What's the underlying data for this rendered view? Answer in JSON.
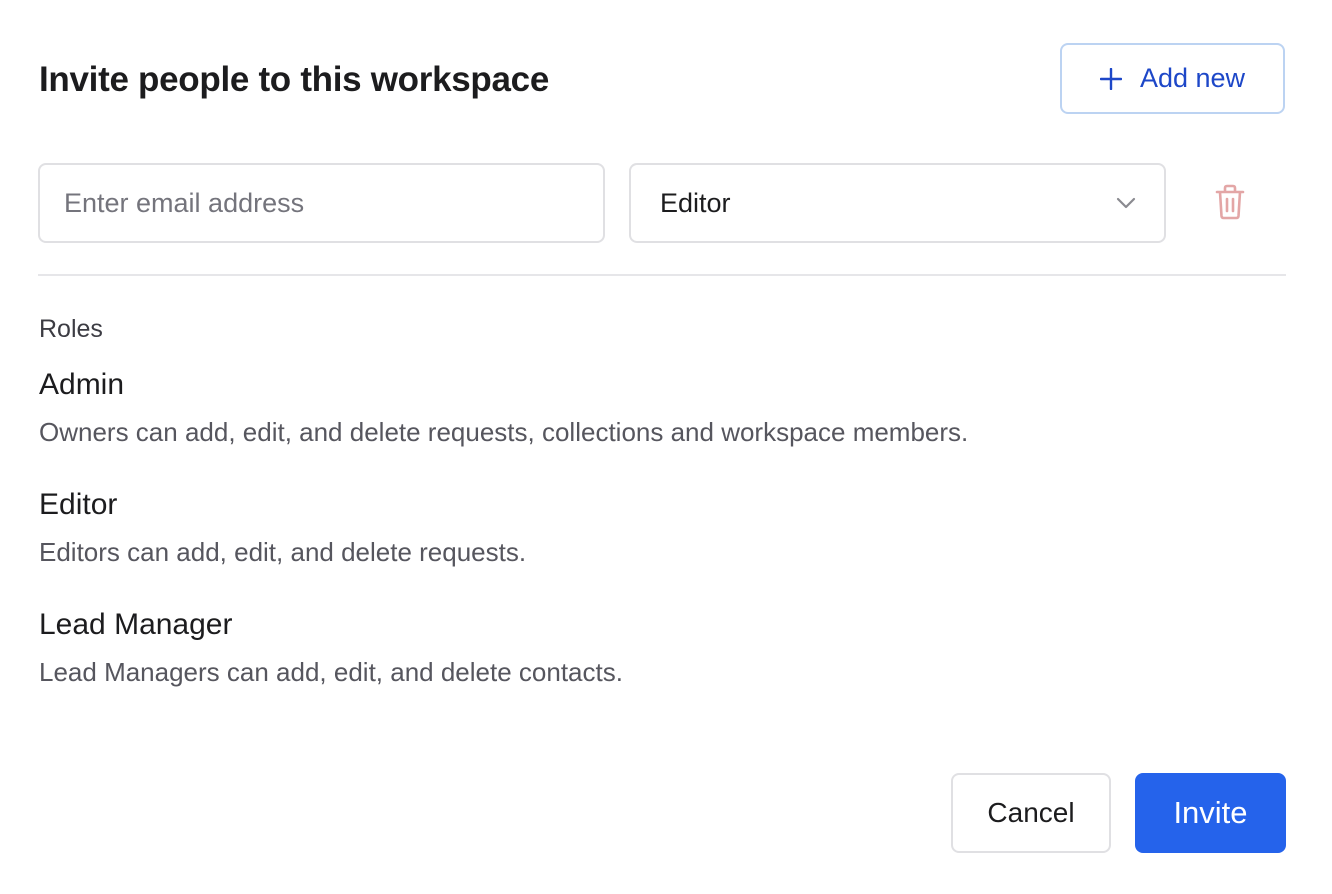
{
  "dialog": {
    "title": "Invite people to this workspace",
    "add_new_label": "Add new",
    "add_new_icon": "plus-icon"
  },
  "invite_row": {
    "email_placeholder": "Enter email address",
    "email_value": "",
    "role_value": "Editor",
    "role_icon": "chevron-down-icon",
    "delete_icon": "trash-icon"
  },
  "roles": {
    "heading": "Roles",
    "items": [
      {
        "name": "Admin",
        "description": "Owners can add, edit, and delete requests, collections and workspace members."
      },
      {
        "name": "Editor",
        "description": "Editors can add, edit, and delete requests."
      },
      {
        "name": "Lead Manager",
        "description": "Lead Managers can add, edit, and delete contacts."
      }
    ]
  },
  "actions": {
    "cancel_label": "Cancel",
    "invite_label": "Invite"
  },
  "colors": {
    "primary": "#2563eb",
    "add_new_text": "#1d47c8",
    "add_new_border": "#bcd3f2",
    "delete_icon": "#e3a6a6",
    "border": "#e0e0e3"
  }
}
